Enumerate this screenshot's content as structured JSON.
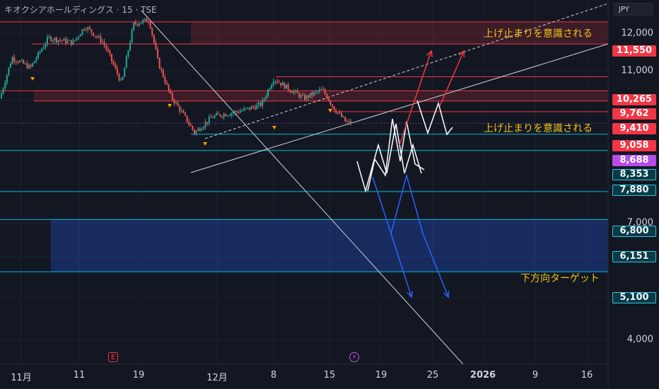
{
  "header": {
    "title": "キオクシアホールディングス · 15 · TSE"
  },
  "currency": "JPY",
  "price_axis": {
    "tick_labels": [
      "12,000",
      "11,000",
      "7,000",
      "4,000"
    ],
    "tags": [
      {
        "label": "11,550",
        "value": 11550,
        "style": "red"
      },
      {
        "label": "10,265",
        "value": 10265,
        "style": "red"
      },
      {
        "label": "9,762",
        "value": 9762,
        "style": "red"
      },
      {
        "label": "9,410",
        "value": 9410,
        "style": "red"
      },
      {
        "label": "9,058",
        "value": 9058,
        "style": "red"
      },
      {
        "label": "8,688",
        "value": 8688,
        "style": "purple"
      },
      {
        "label": "8,353",
        "value": 8353,
        "style": "cyan"
      },
      {
        "label": "7,880",
        "value": 7880,
        "style": "cyan"
      },
      {
        "label": "6,800",
        "value": 6800,
        "style": "cyan"
      },
      {
        "label": "6,151",
        "value": 6151,
        "style": "cyan"
      },
      {
        "label": "5,100",
        "value": 5100,
        "style": "cyan"
      }
    ]
  },
  "time_axis": {
    "labels": [
      "11月",
      "11",
      "19",
      "12月",
      "8",
      "15",
      "19",
      "25",
      "2026",
      "9",
      "16"
    ]
  },
  "annotations": {
    "upper_resistance": "上げ止まりを意識される",
    "mid_resistance": "上げ止まりを意識される",
    "downside_target": "下方向ターゲット"
  },
  "events": {
    "earnings": "E",
    "dividend": "⚡"
  },
  "colors": {
    "background": "#131722",
    "bull": "#26a69a",
    "bear": "#ef5350",
    "resistance_line": "#f23645",
    "support_line": "#00bcd4",
    "annotation_text": "#f0c419",
    "bullish_arrow": "#f23645",
    "bearish_arrow": "#2962ff",
    "scenario_path": "#ffffff"
  },
  "chart_data": {
    "type": "candlestick",
    "title": "キオクシアホールディングス · 15 · TSE",
    "y_axis": {
      "scale": "log",
      "ticks": [
        12000,
        11000,
        7000,
        4000
      ],
      "range": [
        3700,
        13000
      ]
    },
    "x_axis": {
      "labels": [
        "11月",
        "11",
        "19",
        "12月",
        "8",
        "15",
        "19",
        "25",
        "2026",
        "9",
        "16"
      ]
    },
    "horizontal_levels": [
      {
        "value": 11550,
        "color": "resistance"
      },
      {
        "value": 10265,
        "color": "resistance"
      },
      {
        "value": 9762,
        "color": "resistance"
      },
      {
        "value": 9410,
        "color": "resistance"
      },
      {
        "value": 9058,
        "color": "resistance"
      },
      {
        "value": 8353,
        "color": "support"
      },
      {
        "value": 7880,
        "color": "support"
      },
      {
        "value": 6800,
        "color": "support"
      },
      {
        "value": 6151,
        "color": "support"
      },
      {
        "value": 5100,
        "color": "support"
      }
    ],
    "zones": [
      {
        "name": "upper_resistance_zone",
        "from": 11550,
        "to": 12500
      },
      {
        "name": "mid_resistance_zone",
        "from": 9410,
        "to": 9762
      },
      {
        "name": "downside_target_zone",
        "from": 5100,
        "to": 6151
      }
    ],
    "price_path": [
      [
        0,
        9500
      ],
      [
        0.02,
        11000
      ],
      [
        0.05,
        10600
      ],
      [
        0.08,
        11800
      ],
      [
        0.12,
        11600
      ],
      [
        0.14,
        12300
      ],
      [
        0.17,
        11600
      ],
      [
        0.2,
        10000
      ],
      [
        0.22,
        12400
      ],
      [
        0.245,
        12600
      ],
      [
        0.26,
        10800
      ],
      [
        0.28,
        9600
      ],
      [
        0.32,
        8400
      ],
      [
        0.35,
        8900
      ],
      [
        0.4,
        9100
      ],
      [
        0.43,
        9300
      ],
      [
        0.45,
        10200
      ],
      [
        0.47,
        9900
      ],
      [
        0.5,
        9500
      ],
      [
        0.53,
        9800
      ],
      [
        0.55,
        9150
      ],
      [
        0.57,
        8700
      ]
    ],
    "last_price": 8688
  }
}
